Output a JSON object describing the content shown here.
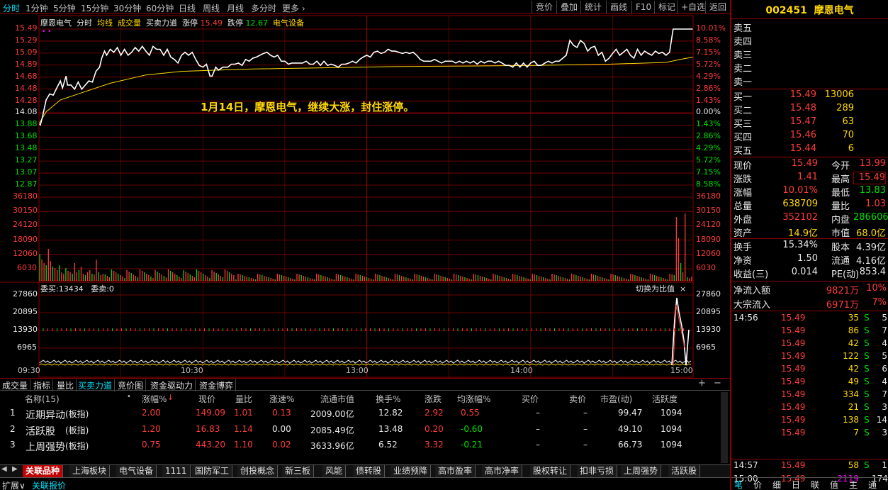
{
  "topbar": {
    "periods": [
      "分时",
      "1分钟",
      "5分钟",
      "15分钟",
      "30分钟",
      "60分钟",
      "日线",
      "周线",
      "月线",
      "多分时",
      "更多"
    ],
    "buttons": [
      "竞价",
      "叠加",
      "统计",
      "画线",
      "F10",
      "标记",
      "+自选",
      "返回"
    ]
  },
  "chart": {
    "stock_name": "摩恩电气",
    "mode": "分时",
    "avg_label": "均线",
    "vol_label": "成交量",
    "power_label": "买卖力道",
    "limit_up_label": "涨停",
    "limit_up_value": "15.49",
    "limit_down_label": "跌停",
    "limit_down_value": "12.67",
    "sector": "电气设备",
    "annotation": "1月14日，摩恩电气，继续大涨，封住涨停。",
    "weimai": "委买:13434",
    "weimai2": "委卖:0",
    "switch_label": "切换为比值"
  },
  "chart_data": {
    "type": "line",
    "price_left_ticks": [
      "15.49",
      "15.29",
      "15.09",
      "14.89",
      "14.68",
      "14.48",
      "14.28",
      "14.08",
      "13.88",
      "13.68",
      "13.48",
      "13.27",
      "13.07",
      "12.87"
    ],
    "price_right_ticks": [
      "10.01%",
      "8.58%",
      "7.15%",
      "5.72%",
      "4.29%",
      "2.86%",
      "1.43%",
      "0.00%",
      "1.43%",
      "2.86%",
      "4.29%",
      "5.72%",
      "7.15%",
      "8.58%"
    ],
    "volume_ticks": [
      "36180",
      "30150",
      "24120",
      "18090",
      "12060",
      "6030"
    ],
    "power_ticks": [
      "27860",
      "20895",
      "13930",
      "6965"
    ],
    "time_ticks": [
      "09:30",
      "10:30",
      "13:00",
      "14:00",
      "15:00"
    ],
    "prev_close": 14.08,
    "ylim": [
      12.67,
      15.49
    ],
    "price_series": [
      [
        0,
        13.9
      ],
      [
        2,
        13.88
      ],
      [
        5,
        14.02
      ],
      [
        10,
        14.3
      ],
      [
        15,
        14.4
      ],
      [
        20,
        14.38
      ],
      [
        25,
        14.5
      ],
      [
        30,
        14.62
      ],
      [
        33,
        14.5
      ],
      [
        38,
        14.7
      ],
      [
        40,
        14.55
      ],
      [
        45,
        14.55
      ],
      [
        50,
        14.48
      ],
      [
        55,
        14.6
      ],
      [
        60,
        14.48
      ],
      [
        65,
        14.55
      ],
      [
        70,
        14.62
      ],
      [
        75,
        14.6
      ],
      [
        80,
        14.78
      ],
      [
        85,
        14.85
      ],
      [
        88,
        15.0
      ],
      [
        92,
        15.12
      ],
      [
        95,
        15.05
      ],
      [
        100,
        15.15
      ],
      [
        105,
        15.1
      ],
      [
        110,
        15.18
      ],
      [
        115,
        15.05
      ],
      [
        120,
        15.15
      ],
      [
        125,
        15.05
      ],
      [
        130,
        15.1
      ],
      [
        135,
        15.18
      ],
      [
        140,
        15.12
      ],
      [
        145,
        15.2
      ],
      [
        150,
        15.12
      ],
      [
        155,
        15.05
      ],
      [
        160,
        15.2
      ],
      [
        165,
        15.15
      ],
      [
        170,
        15.15
      ],
      [
        175,
        15.05
      ],
      [
        180,
        15.15
      ],
      [
        185,
        15.02
      ],
      [
        190,
        14.98
      ],
      [
        195,
        14.92
      ],
      [
        200,
        15.05
      ],
      [
        205,
        15.1
      ],
      [
        210,
        15.05
      ],
      [
        215,
        15.1
      ],
      [
        220,
        14.98
      ],
      [
        225,
        14.88
      ],
      [
        230,
        14.85
      ],
      [
        235,
        14.9
      ],
      [
        240,
        14.7
      ],
      [
        243,
        14.7
      ],
      [
        248,
        14.85
      ],
      [
        252,
        14.8
      ],
      [
        258,
        14.85
      ],
      [
        265,
        14.85
      ],
      [
        270,
        14.9
      ],
      [
        275,
        14.9
      ],
      [
        280,
        14.92
      ],
      [
        285,
        14.88
      ],
      [
        290,
        14.98
      ],
      [
        295,
        14.95
      ],
      [
        300,
        15.0
      ],
      [
        305,
        15.02
      ],
      [
        310,
        15.05
      ],
      [
        315,
        15.08
      ],
      [
        320,
        15.1
      ],
      [
        325,
        15.05
      ],
      [
        330,
        15.02
      ],
      [
        335,
        15.05
      ],
      [
        340,
        14.95
      ],
      [
        345,
        14.95
      ],
      [
        350,
        14.9
      ],
      [
        355,
        14.92
      ],
      [
        360,
        14.92
      ],
      [
        365,
        14.92
      ],
      [
        370,
        14.92
      ],
      [
        375,
        14.95
      ],
      [
        380,
        14.9
      ],
      [
        385,
        14.9
      ],
      [
        390,
        14.95
      ],
      [
        395,
        14.88
      ],
      [
        400,
        14.95
      ],
      [
        405,
        14.88
      ],
      [
        410,
        14.9
      ],
      [
        415,
        14.88
      ],
      [
        420,
        14.85
      ],
      [
        425,
        14.9
      ],
      [
        430,
        14.9
      ],
      [
        435,
        14.92
      ],
      [
        440,
        14.95
      ],
      [
        445,
        14.92
      ],
      [
        450,
        14.98
      ],
      [
        455,
        15.02
      ],
      [
        460,
        15.05
      ],
      [
        465,
        15.02
      ],
      [
        470,
        15.1
      ],
      [
        475,
        15.12
      ],
      [
        480,
        15.08
      ],
      [
        485,
        15.1
      ],
      [
        490,
        15.15
      ],
      [
        495,
        15.12
      ],
      [
        500,
        15.12
      ],
      [
        505,
        15.1
      ],
      [
        510,
        15.08
      ],
      [
        515,
        15.1
      ],
      [
        520,
        15.08
      ],
      [
        525,
        15.1
      ],
      [
        530,
        15.05
      ],
      [
        535,
        14.98
      ],
      [
        540,
        14.95
      ],
      [
        545,
        14.95
      ],
      [
        550,
        14.95
      ],
      [
        555,
        14.98
      ],
      [
        560,
        14.95
      ],
      [
        565,
        14.92
      ],
      [
        570,
        14.95
      ],
      [
        575,
        14.95
      ],
      [
        580,
        14.95
      ],
      [
        585,
        14.92
      ],
      [
        590,
        14.95
      ],
      [
        595,
        14.92
      ],
      [
        600,
        14.95
      ],
      [
        605,
        14.92
      ],
      [
        610,
        14.95
      ],
      [
        615,
        14.9
      ],
      [
        620,
        14.95
      ],
      [
        625,
        14.92
      ],
      [
        630,
        14.95
      ],
      [
        635,
        14.95
      ],
      [
        640,
        14.92
      ],
      [
        645,
        14.95
      ],
      [
        650,
        14.92
      ],
      [
        655,
        14.88
      ],
      [
        660,
        14.88
      ],
      [
        665,
        14.85
      ],
      [
        670,
        14.92
      ],
      [
        675,
        14.85
      ],
      [
        680,
        14.92
      ],
      [
        685,
        14.85
      ],
      [
        690,
        14.92
      ],
      [
        695,
        14.95
      ],
      [
        700,
        14.88
      ],
      [
        705,
        14.88
      ],
      [
        710,
        14.92
      ],
      [
        715,
        14.95
      ],
      [
        720,
        14.92
      ],
      [
        725,
        14.95
      ],
      [
        730,
        14.95
      ],
      [
        735,
        15.0
      ],
      [
        740,
        15.05
      ],
      [
        745,
        15.3
      ],
      [
        750,
        15.22
      ],
      [
        755,
        15.18
      ],
      [
        760,
        15.3
      ],
      [
        765,
        15.25
      ],
      [
        770,
        15.12
      ],
      [
        775,
        15.18
      ],
      [
        780,
        15.2
      ],
      [
        785,
        15.05
      ],
      [
        790,
        15.1
      ],
      [
        795,
        14.95
      ],
      [
        800,
        15.0
      ],
      [
        805,
        15.08
      ],
      [
        810,
        15.15
      ],
      [
        815,
        15.05
      ],
      [
        820,
        15.1
      ],
      [
        825,
        15.15
      ],
      [
        830,
        15.05
      ],
      [
        835,
        15.0
      ],
      [
        840,
        15.15
      ],
      [
        845,
        15.05
      ],
      [
        850,
        15.12
      ],
      [
        855,
        15.08
      ],
      [
        860,
        15.05
      ],
      [
        865,
        15.12
      ],
      [
        870,
        15.08
      ],
      [
        875,
        15.1
      ],
      [
        880,
        15.05
      ],
      [
        885,
        15.1
      ],
      [
        890,
        15.49
      ],
      [
        900,
        15.49
      ],
      [
        918,
        15.49
      ]
    ],
    "avg_series": [
      [
        0,
        13.9
      ],
      [
        10,
        14.1
      ],
      [
        30,
        14.3
      ],
      [
        60,
        14.42
      ],
      [
        100,
        14.58
      ],
      [
        150,
        14.72
      ],
      [
        200,
        14.78
      ],
      [
        250,
        14.8
      ],
      [
        300,
        14.82
      ],
      [
        400,
        14.84
      ],
      [
        500,
        14.86
      ],
      [
        600,
        14.87
      ],
      [
        700,
        14.88
      ],
      [
        800,
        14.9
      ],
      [
        880,
        14.93
      ],
      [
        900,
        14.98
      ],
      [
        918,
        15.02
      ]
    ]
  },
  "tabs": [
    "成交量",
    "指标",
    "量比",
    "买卖力道",
    "竞价图",
    "资金驱动力",
    "资金博弈"
  ],
  "table": {
    "headers": [
      "名称(15)",
      "涨幅%",
      "现价",
      "量比",
      "涨速%",
      "流通市值",
      "换手%",
      "涨跌",
      "均涨幅%",
      "买价",
      "卖价",
      "市盈(动)",
      "活跃度"
    ],
    "rows": [
      {
        "idx": "1",
        "name": "近期异动",
        "tag": "(板指)",
        "chg": "2.00",
        "price": "149.09",
        "lb": "1.01",
        "speed": "0.13",
        "cap": "2009.00亿",
        "turn": "12.82",
        "diff": "2.92",
        "avg": "0.55",
        "buy": "–",
        "sell": "–",
        "pe": "99.47",
        "act": "1094"
      },
      {
        "idx": "2",
        "name": "活跃股",
        "tag": "(板指)",
        "chg": "1.20",
        "price": "16.83",
        "lb": "1.14",
        "speed": "0.00",
        "cap": "2085.49亿",
        "turn": "13.48",
        "diff": "0.20",
        "avg": "-0.60",
        "buy": "–",
        "sell": "–",
        "pe": "49.10",
        "act": "1094"
      },
      {
        "idx": "3",
        "name": "上周强势",
        "tag": "(板指)",
        "chg": "0.75",
        "price": "443.20",
        "lb": "1.10",
        "speed": "0.02",
        "cap": "3633.96亿",
        "turn": "6.52",
        "diff": "3.32",
        "avg": "-0.21",
        "buy": "–",
        "sell": "–",
        "pe": "66.73",
        "act": "1094"
      }
    ]
  },
  "bottom_tabs": [
    "关联品种",
    "上海板块",
    "电气设备",
    "1111",
    "国防军工",
    "创投概念",
    "新三板",
    "风能",
    "债转股",
    "业绩预降",
    "高市盈率",
    "高市净率",
    "股权转让",
    "扣非亏损",
    "上周强势",
    "活跃股"
  ],
  "status": {
    "left": "扩展∨",
    "right": "关联报价"
  },
  "rp": {
    "code": "002451",
    "name": "摩恩电气",
    "sells": [
      {
        "label": "卖五",
        "price": "",
        "vol": ""
      },
      {
        "label": "卖四",
        "price": "",
        "vol": ""
      },
      {
        "label": "卖三",
        "price": "",
        "vol": ""
      },
      {
        "label": "卖二",
        "price": "",
        "vol": ""
      },
      {
        "label": "卖一",
        "price": "",
        "vol": ""
      }
    ],
    "buys": [
      {
        "label": "买一",
        "price": "15.49",
        "vol": "13006"
      },
      {
        "label": "买二",
        "price": "15.48",
        "vol": "289"
      },
      {
        "label": "买三",
        "price": "15.47",
        "vol": "63"
      },
      {
        "label": "买四",
        "price": "15.46",
        "vol": "70"
      },
      {
        "label": "买五",
        "price": "15.44",
        "vol": "6"
      }
    ],
    "q": [
      {
        "l1": "现价",
        "v1": "15.49",
        "l2": "今开",
        "v2": "13.99"
      },
      {
        "l1": "涨跌",
        "v1": "1.41",
        "l2": "最高",
        "v2": "15.49"
      },
      {
        "l1": "涨幅",
        "v1": "10.01%",
        "l2": "最低",
        "v2": "13.83"
      },
      {
        "l1": "总量",
        "v1": "638709",
        "l2": "量比",
        "v2": "1.03"
      },
      {
        "l1": "外盘",
        "v1": "352102",
        "l2": "内盘",
        "v2": "286606"
      },
      {
        "l1": "资产",
        "v1": "14.9亿",
        "l2": "市值",
        "v2": "68.0亿"
      }
    ],
    "f": [
      {
        "l1": "换手",
        "v1": "15.34%",
        "l2": "股本",
        "v2": "4.39亿"
      },
      {
        "l1": "净资",
        "v1": "1.50",
        "l2": "流通",
        "v2": "4.16亿"
      },
      {
        "l1": "收益(三)",
        "v1": "0.014",
        "l2": "PE(动)",
        "v2": "853.4"
      }
    ],
    "flow": [
      {
        "l": "净流入额",
        "v": "9821万",
        "p": "10%"
      },
      {
        "l": "大宗流入",
        "v": "6971万",
        "p": "7%"
      }
    ],
    "ticks": [
      {
        "t": "14:56",
        "p": "15.49",
        "v": "35",
        "s": "S",
        "n": "5"
      },
      {
        "t": "",
        "p": "15.49",
        "v": "86",
        "s": "S",
        "n": "7"
      },
      {
        "t": "",
        "p": "15.49",
        "v": "42",
        "s": "S",
        "n": "4"
      },
      {
        "t": "",
        "p": "15.49",
        "v": "122",
        "s": "S",
        "n": "5"
      },
      {
        "t": "",
        "p": "15.49",
        "v": "42",
        "s": "S",
        "n": "6"
      },
      {
        "t": "",
        "p": "15.49",
        "v": "49",
        "s": "S",
        "n": "4"
      },
      {
        "t": "",
        "p": "15.49",
        "v": "334",
        "s": "S",
        "n": "7"
      },
      {
        "t": "",
        "p": "15.49",
        "v": "21",
        "s": "S",
        "n": "3"
      },
      {
        "t": "",
        "p": "15.49",
        "v": "138",
        "s": "S",
        "n": "14"
      },
      {
        "t": "",
        "p": "15.49",
        "v": "7",
        "s": "S",
        "n": "3"
      },
      {
        "t": "14:57",
        "p": "15.49",
        "v": "58",
        "s": "S",
        "n": "1"
      },
      {
        "t": "15:00",
        "p": "15.49",
        "v": "2119",
        "s": "",
        "n": "174"
      }
    ],
    "bottom": [
      "笔",
      "价",
      "细",
      "日",
      "联",
      "值",
      "主",
      "通"
    ]
  }
}
